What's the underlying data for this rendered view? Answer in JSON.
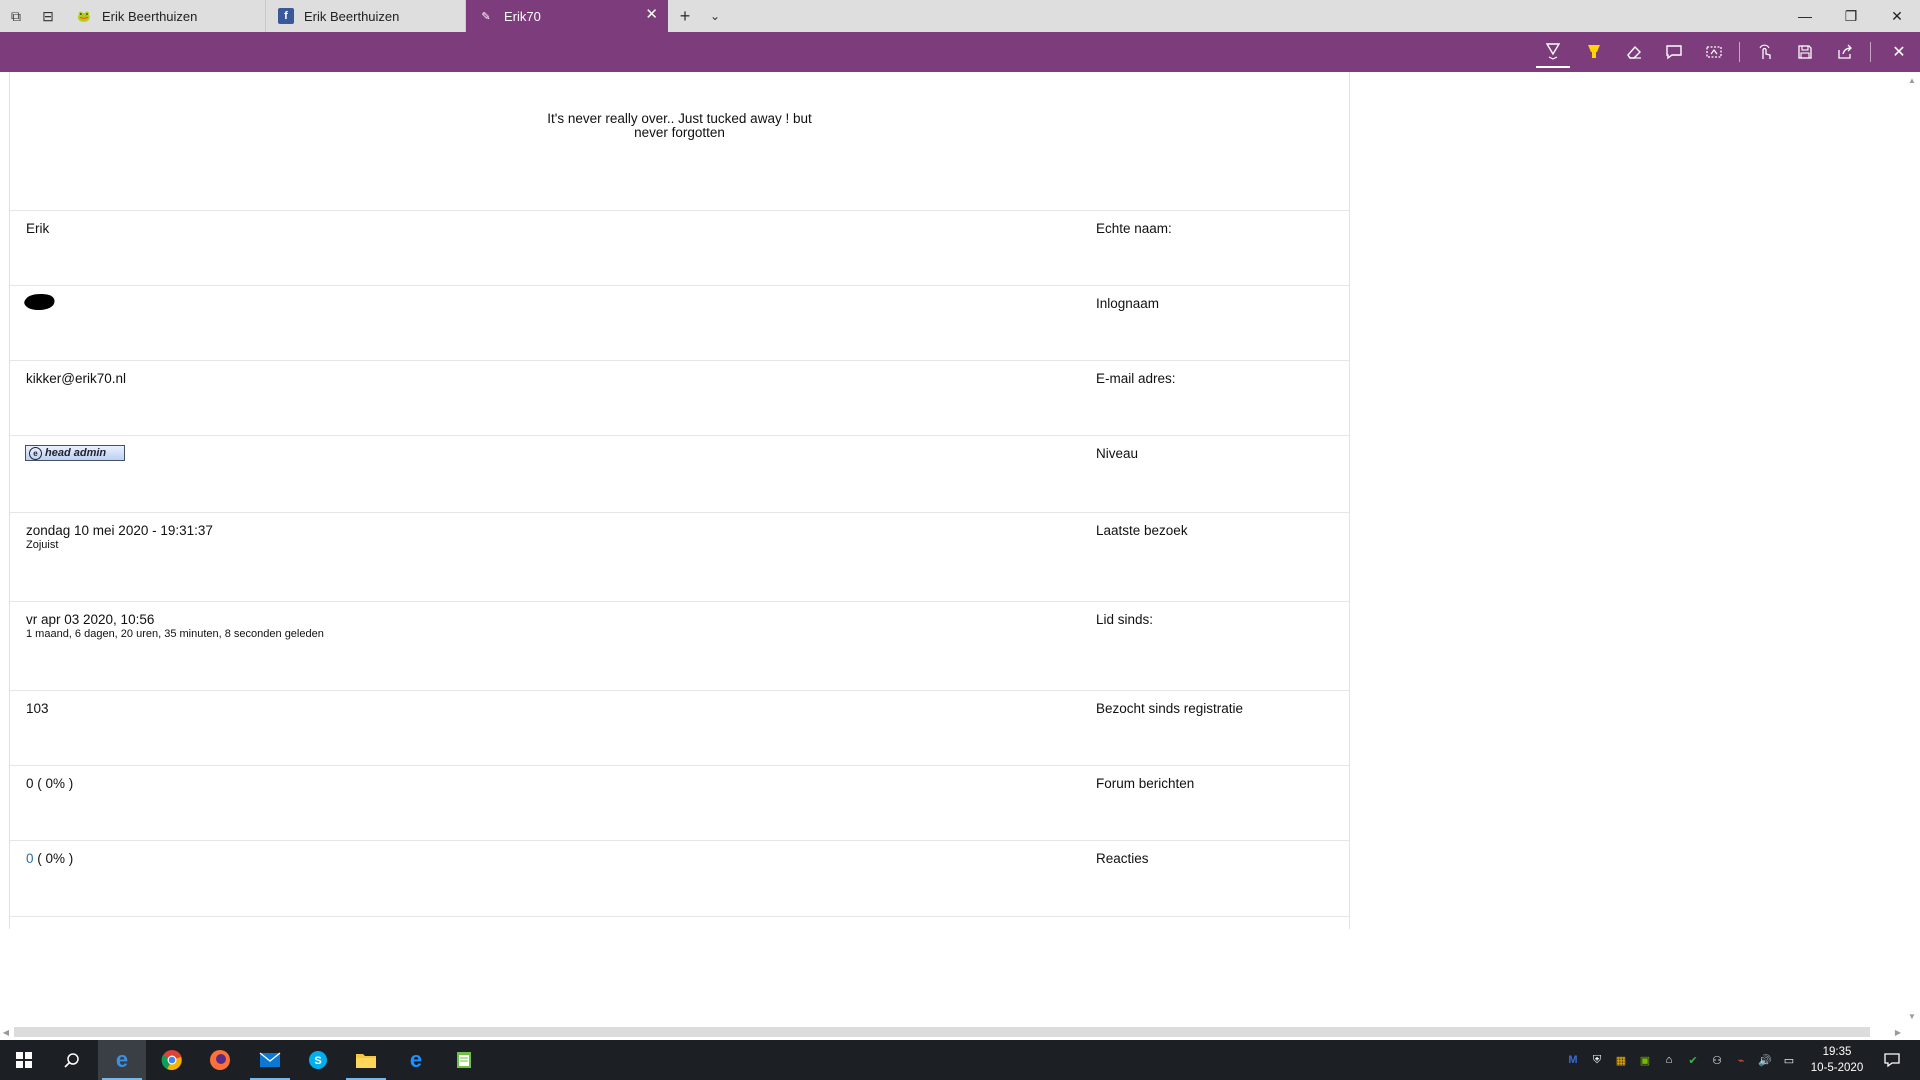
{
  "browser": {
    "tabs": [
      {
        "title": "Erik Beerthuizen",
        "icon": "frog-icon",
        "active": false
      },
      {
        "title": "Erik Beerthuizen",
        "icon": "facebook-icon",
        "active": false
      },
      {
        "title": "Erik70",
        "icon": "pen-icon",
        "active": true
      }
    ],
    "colors": {
      "accent": "#7d3c7c",
      "tabbar": "#dedede"
    }
  },
  "annotation_toolbar": {
    "tools": [
      "ballpoint-pen-icon",
      "highlighter-icon",
      "eraser-icon",
      "add-note-icon",
      "clip-icon",
      "touch-writing-icon",
      "save-icon",
      "share-icon",
      "exit-icon"
    ]
  },
  "profile": {
    "quote": "It's never really over.. Just tucked away ! but never forgotten",
    "rows": [
      {
        "label": "Echte naam:",
        "value": "Erik"
      },
      {
        "label": "Inlognaam",
        "value": ""
      },
      {
        "label": "E-mail adres:",
        "value": "kikker@erik70.nl"
      },
      {
        "label": "Niveau",
        "value": "head admin"
      },
      {
        "label": "Laatste bezoek",
        "value": "zondag 10 mei 2020 - 19:31:37",
        "sub": "Zojuist"
      },
      {
        "label": "Lid sinds:",
        "value": "vr apr 03 2020, 10:56",
        "sub": "1 maand, 6 dagen, 20 uren, 35 minuten, 8 seconden geleden"
      },
      {
        "label": "Bezocht sinds registratie",
        "value": "103"
      },
      {
        "label": "Forum berichten",
        "value": "0 ( 0% )"
      },
      {
        "label": "Reacties",
        "link_value": "0",
        "value": " ( 0% )"
      }
    ]
  },
  "taskbar": {
    "apps": [
      "start-icon",
      "search-icon",
      "edge-icon",
      "chrome-icon",
      "firefox-icon",
      "mail-icon",
      "skype-icon",
      "file-explorer-icon",
      "internet-explorer-icon",
      "notepad-icon"
    ],
    "time": "19:35",
    "date": "10-5-2020"
  }
}
